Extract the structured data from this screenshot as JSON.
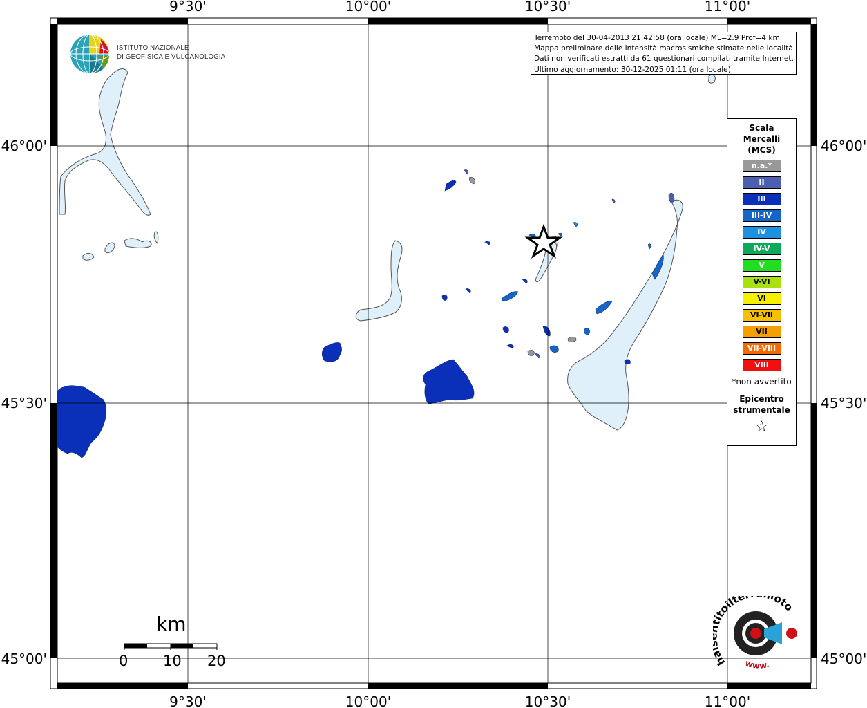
{
  "info": {
    "line1": "Terremoto del 30-04-2013 21:42:58 (ora locale) ML=2.9 Prof=4 km",
    "line2": "Mappa preliminare delle intensità macrosismiche stimate nelle località",
    "line3": "Dati non verificati estratti da 61 questionari compilati tramite Internet.",
    "line4": "Ultimo aggiornamento: 30-12-2025 01:11 (ora locale)"
  },
  "logo": {
    "line1": "ISTITUTO NAZIONALE",
    "line2": "DI GEOFISICA E VULCANOLOGIA"
  },
  "axes": {
    "lon_labels": [
      "9°30'",
      "10°00'",
      "10°30'",
      "11°00'"
    ],
    "lat_labels": [
      "46°00'",
      "45°30'",
      "45°00'"
    ]
  },
  "legend": {
    "title1": "Scala",
    "title2": "Mercalli",
    "title3": "(MCS)",
    "items": [
      {
        "label": "n.a.*",
        "color": "#999999"
      },
      {
        "label": "II",
        "color": "#4a5fb0"
      },
      {
        "label": "III",
        "color": "#0a2fb8"
      },
      {
        "label": "III-IV",
        "color": "#1565c8"
      },
      {
        "label": "IV",
        "color": "#1e90e0"
      },
      {
        "label": "IV-V",
        "color": "#0da85a"
      },
      {
        "label": "V",
        "color": "#22dd22"
      },
      {
        "label": "V-VI",
        "color": "#a8e010"
      },
      {
        "label": "VI",
        "color": "#f5f000"
      },
      {
        "label": "VI-VII",
        "color": "#f5c000"
      },
      {
        "label": "VII",
        "color": "#f5a000"
      },
      {
        "label": "VII-VIII",
        "color": "#f56a00"
      },
      {
        "label": "VIII",
        "color": "#f01010"
      }
    ],
    "note": "*non avvertito",
    "epi1": "Epicentro",
    "epi2": "strumentale",
    "epi_symbol": "☆"
  },
  "scalebar": {
    "unit": "km",
    "labels": [
      "0",
      "10",
      "20"
    ]
  },
  "site": {
    "text1": "haisentitoilterremoto.it",
    "text2": "www."
  },
  "colors": {
    "lake": "#dff0fa",
    "grid": "#000000"
  }
}
